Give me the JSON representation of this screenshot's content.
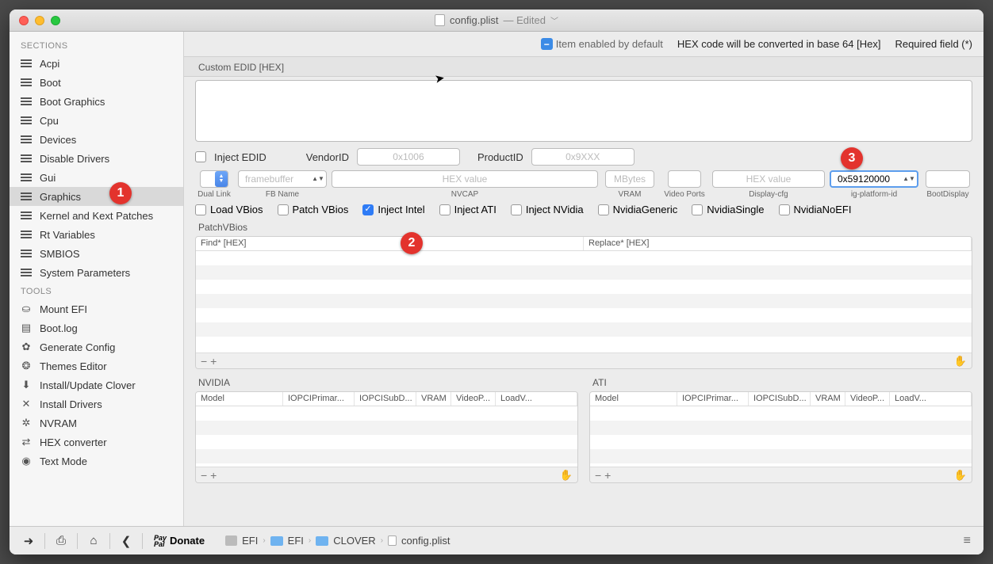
{
  "window": {
    "title": "config.plist",
    "edited": "— Edited"
  },
  "infobar": {
    "enabled": "Item enabled by default",
    "hex": "HEX code will be converted in base 64 [Hex]",
    "required": "Required field (*)"
  },
  "sidebar": {
    "sections_head": "SECTIONS",
    "sections": [
      "Acpi",
      "Boot",
      "Boot Graphics",
      "Cpu",
      "Devices",
      "Disable Drivers",
      "Gui",
      "Graphics",
      "Kernel and Kext Patches",
      "Rt Variables",
      "SMBIOS",
      "System Parameters"
    ],
    "tools_head": "TOOLS",
    "tools": [
      "Mount EFI",
      "Boot.log",
      "Generate Config",
      "Themes Editor",
      "Install/Update Clover",
      "Install Drivers",
      "NVRAM",
      "HEX converter",
      "Text Mode"
    ]
  },
  "edid": {
    "panel_title": "Custom EDID [HEX]",
    "inject_label": "Inject EDID",
    "vendor_label": "VendorID",
    "vendor_ph": "0x1006",
    "product_label": "ProductID",
    "product_ph": "0x9XXX"
  },
  "row2": {
    "dual_link": "Dual Link",
    "framebuffer": "framebuffer",
    "fb_name": "FB Name",
    "nvcap_ph": "HEX value",
    "nvcap": "NVCAP",
    "vram_ph": "MBytes",
    "vram": "VRAM",
    "video_ports": "Video Ports",
    "display_cfg_ph": "HEX value",
    "display_cfg": "Display-cfg",
    "ig_value": "0x59120000",
    "ig": "ig-platform-id",
    "boot_display": "BootDisplay"
  },
  "inject": {
    "load_vbios": "Load VBios",
    "patch_vbios": "Patch VBios",
    "inject_intel": "Inject Intel",
    "inject_ati": "Inject ATI",
    "inject_nvidia": "Inject NVidia",
    "nvidia_generic": "NvidiaGeneric",
    "nvidia_single": "NvidiaSingle",
    "nvidia_noefi": "NvidiaNoEFI"
  },
  "patchvbios": {
    "title": "PatchVBios",
    "find": "Find* [HEX]",
    "replace": "Replace* [HEX]"
  },
  "gpu": {
    "nvidia": "NVIDIA",
    "ati": "ATI",
    "cols": {
      "model": "Model",
      "iopci_prim": "IOPCIPrimar...",
      "iopci_sub": "IOPCISubD...",
      "vram": "VRAM",
      "videop": "VideoP...",
      "loadv": "LoadV..."
    }
  },
  "bottom": {
    "donate": "Donate",
    "crumb1": "EFI",
    "crumb2": "EFI",
    "crumb3": "CLOVER",
    "crumb4": "config.plist"
  },
  "badges": {
    "b1": "1",
    "b2": "2",
    "b3": "3"
  }
}
